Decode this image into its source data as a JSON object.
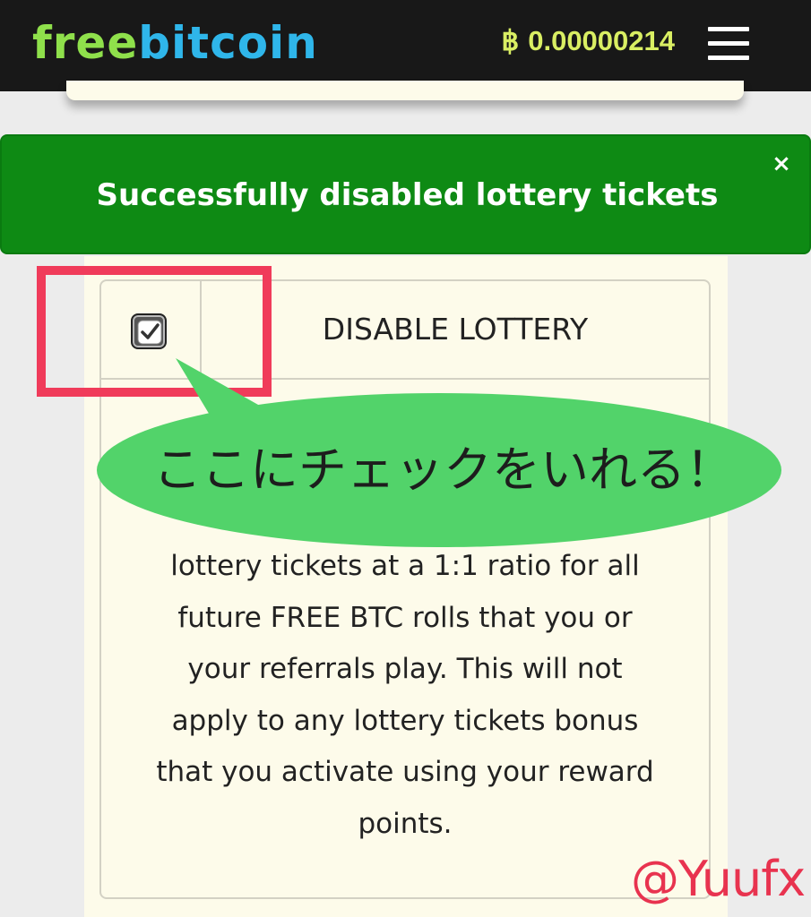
{
  "header": {
    "logo_part1": "free",
    "logo_part2": "bitcoin",
    "balance_symbol": "฿",
    "balance_value": "0.00000214"
  },
  "alert": {
    "message": "Successfully disabled lottery tickets",
    "close_symbol": "×",
    "color": "#0e8a14"
  },
  "settings": {
    "checkbox_checked": true,
    "option_label": "DISABLE LOTTERY",
    "description_lines": [
      "lottery tickets at a 1:1 ratio for all",
      "future FREE BTC rolls that you or",
      "your referrals play. This will not",
      "apply to any lottery tickets bonus",
      "that you activate using your reward",
      "points."
    ]
  },
  "annotation": {
    "bubble_text": "ここにチェックをいれる！",
    "bubble_color": "#52d36a",
    "frame_color": "#f03b5a",
    "watermark": "@Yuufx"
  },
  "icons": {
    "menu": "hamburger-menu-icon",
    "close": "close-icon",
    "check": "checkmark-icon"
  }
}
